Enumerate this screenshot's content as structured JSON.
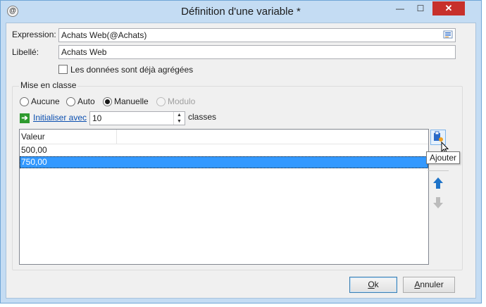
{
  "window": {
    "title": "Définition d'une variable *",
    "controls": {
      "minimize": "—",
      "maximize": "☐",
      "close": "✕"
    },
    "app_icon": "@"
  },
  "form": {
    "expression_label": "Expression:",
    "expression_value": "Achats Web(@Achats)",
    "libelle_label": "Libellé:",
    "libelle_value": "Achats Web",
    "aggregated_checkbox": {
      "label": "Les données sont déjà agrégées",
      "checked": false
    }
  },
  "binning": {
    "group_title": "Mise en classe",
    "options": [
      {
        "label": "Aucune",
        "selected": false,
        "disabled": false
      },
      {
        "label": "Auto",
        "selected": false,
        "disabled": false
      },
      {
        "label": "Manuelle",
        "selected": true,
        "disabled": false
      },
      {
        "label": "Modulo",
        "selected": false,
        "disabled": true
      }
    ],
    "init_link": "Initialiser avec",
    "init_value": "10",
    "classes_label": "classes",
    "table": {
      "column_header": "Valeur",
      "rows": [
        {
          "value": "500,00",
          "selected": false
        },
        {
          "value": "750,00",
          "selected": true
        }
      ]
    },
    "side_buttons": {
      "add_icon": "add-row-icon",
      "add_tooltip": "Ajouter",
      "up_icon": "arrow-up-icon",
      "down_icon": "arrow-down-icon"
    }
  },
  "footer": {
    "ok_label": "Ok",
    "ok_accel": "O",
    "ok_rest": "k",
    "cancel_accel": "A",
    "cancel_rest": "nnuler"
  },
  "colors": {
    "titlebar": "#c4dcf3",
    "close_button": "#c7302b",
    "selection": "#3399ff",
    "link": "#0b4fb0",
    "arrow_up": "#1e73c8",
    "arrow_down": "#bcbcbc"
  }
}
